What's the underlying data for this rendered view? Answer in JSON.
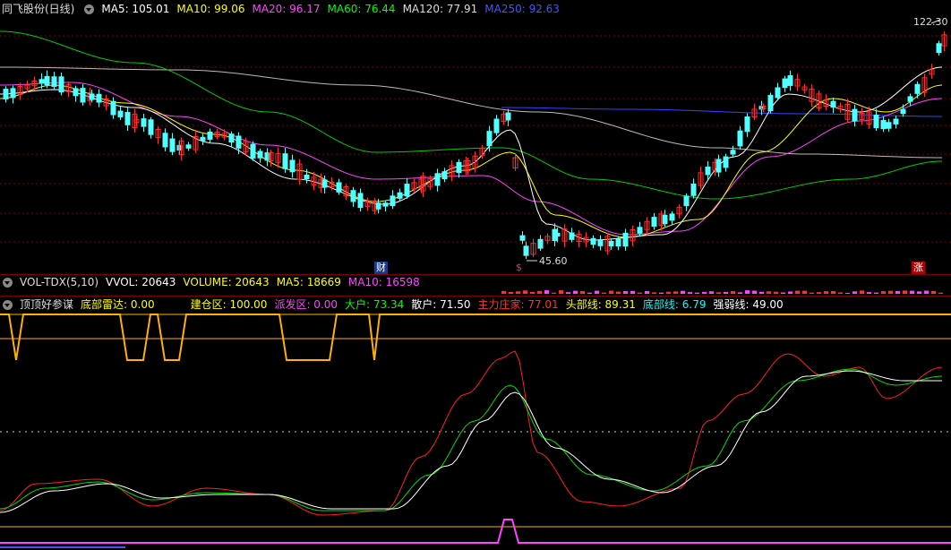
{
  "main_header": {
    "stock_name": "同飞股份(日线)",
    "ma_items": [
      {
        "label": "MA5: 105.01",
        "color": "#ffffff"
      },
      {
        "label": "MA10: 99.06",
        "color": "#ffff00"
      },
      {
        "label": "MA20: 96.17",
        "color": "#ff44ff"
      },
      {
        "label": "MA60: 76.44",
        "color": "#00ff00"
      },
      {
        "label": "MA120: 77.91",
        "color": "#dddddd"
      },
      {
        "label": "MA250: 92.63",
        "color": "#4455ff"
      }
    ]
  },
  "price_panel": {
    "high_label": "122.30",
    "low_label": "45.60",
    "marker_cai": "财",
    "marker_s": "$",
    "marker_zhang": "涨"
  },
  "vol_header": {
    "items": [
      {
        "label": "VOL-TDX(5,10)",
        "color": "#dddddd"
      },
      {
        "label": "VVOL: 20643",
        "color": "#ffffff"
      },
      {
        "label": "VOLUME: 20643",
        "color": "#ffff00"
      },
      {
        "label": "MA5: 18669",
        "color": "#ffff00"
      },
      {
        "label": "MA10: 16598",
        "color": "#ff44ff"
      }
    ]
  },
  "indicator_header": {
    "items": [
      {
        "label": "顶顶好参谋",
        "color": "#dddddd"
      },
      {
        "label": "底部雷达: 0.00",
        "color": "#ffff00"
      },
      {
        "label": "建仓区: 100.00",
        "color": "#ffff00"
      },
      {
        "label": "派发区: 0.00",
        "color": "#ff44ff"
      },
      {
        "label": "大户: 73.34",
        "color": "#00ff00"
      },
      {
        "label": "散户: 71.50",
        "color": "#ffffff"
      },
      {
        "label": "主力庄家: 77.01",
        "color": "#ff3333"
      },
      {
        "label": "头部线: 89.31",
        "color": "#ffff00"
      },
      {
        "label": "底部线: 6.79",
        "color": "#00ffff"
      },
      {
        "label": "强弱线: 49.00",
        "color": "#ffffff"
      }
    ]
  },
  "colors": {
    "up": "#ff3030",
    "down": "#54ffff",
    "grid": "#7a0000",
    "ma5": "#ffffff",
    "ma10": "#ffff00",
    "ma20": "#ff44ff",
    "ma60": "#00cc00",
    "ma120": "#bbbbbb",
    "ma250": "#3344ff"
  }
}
